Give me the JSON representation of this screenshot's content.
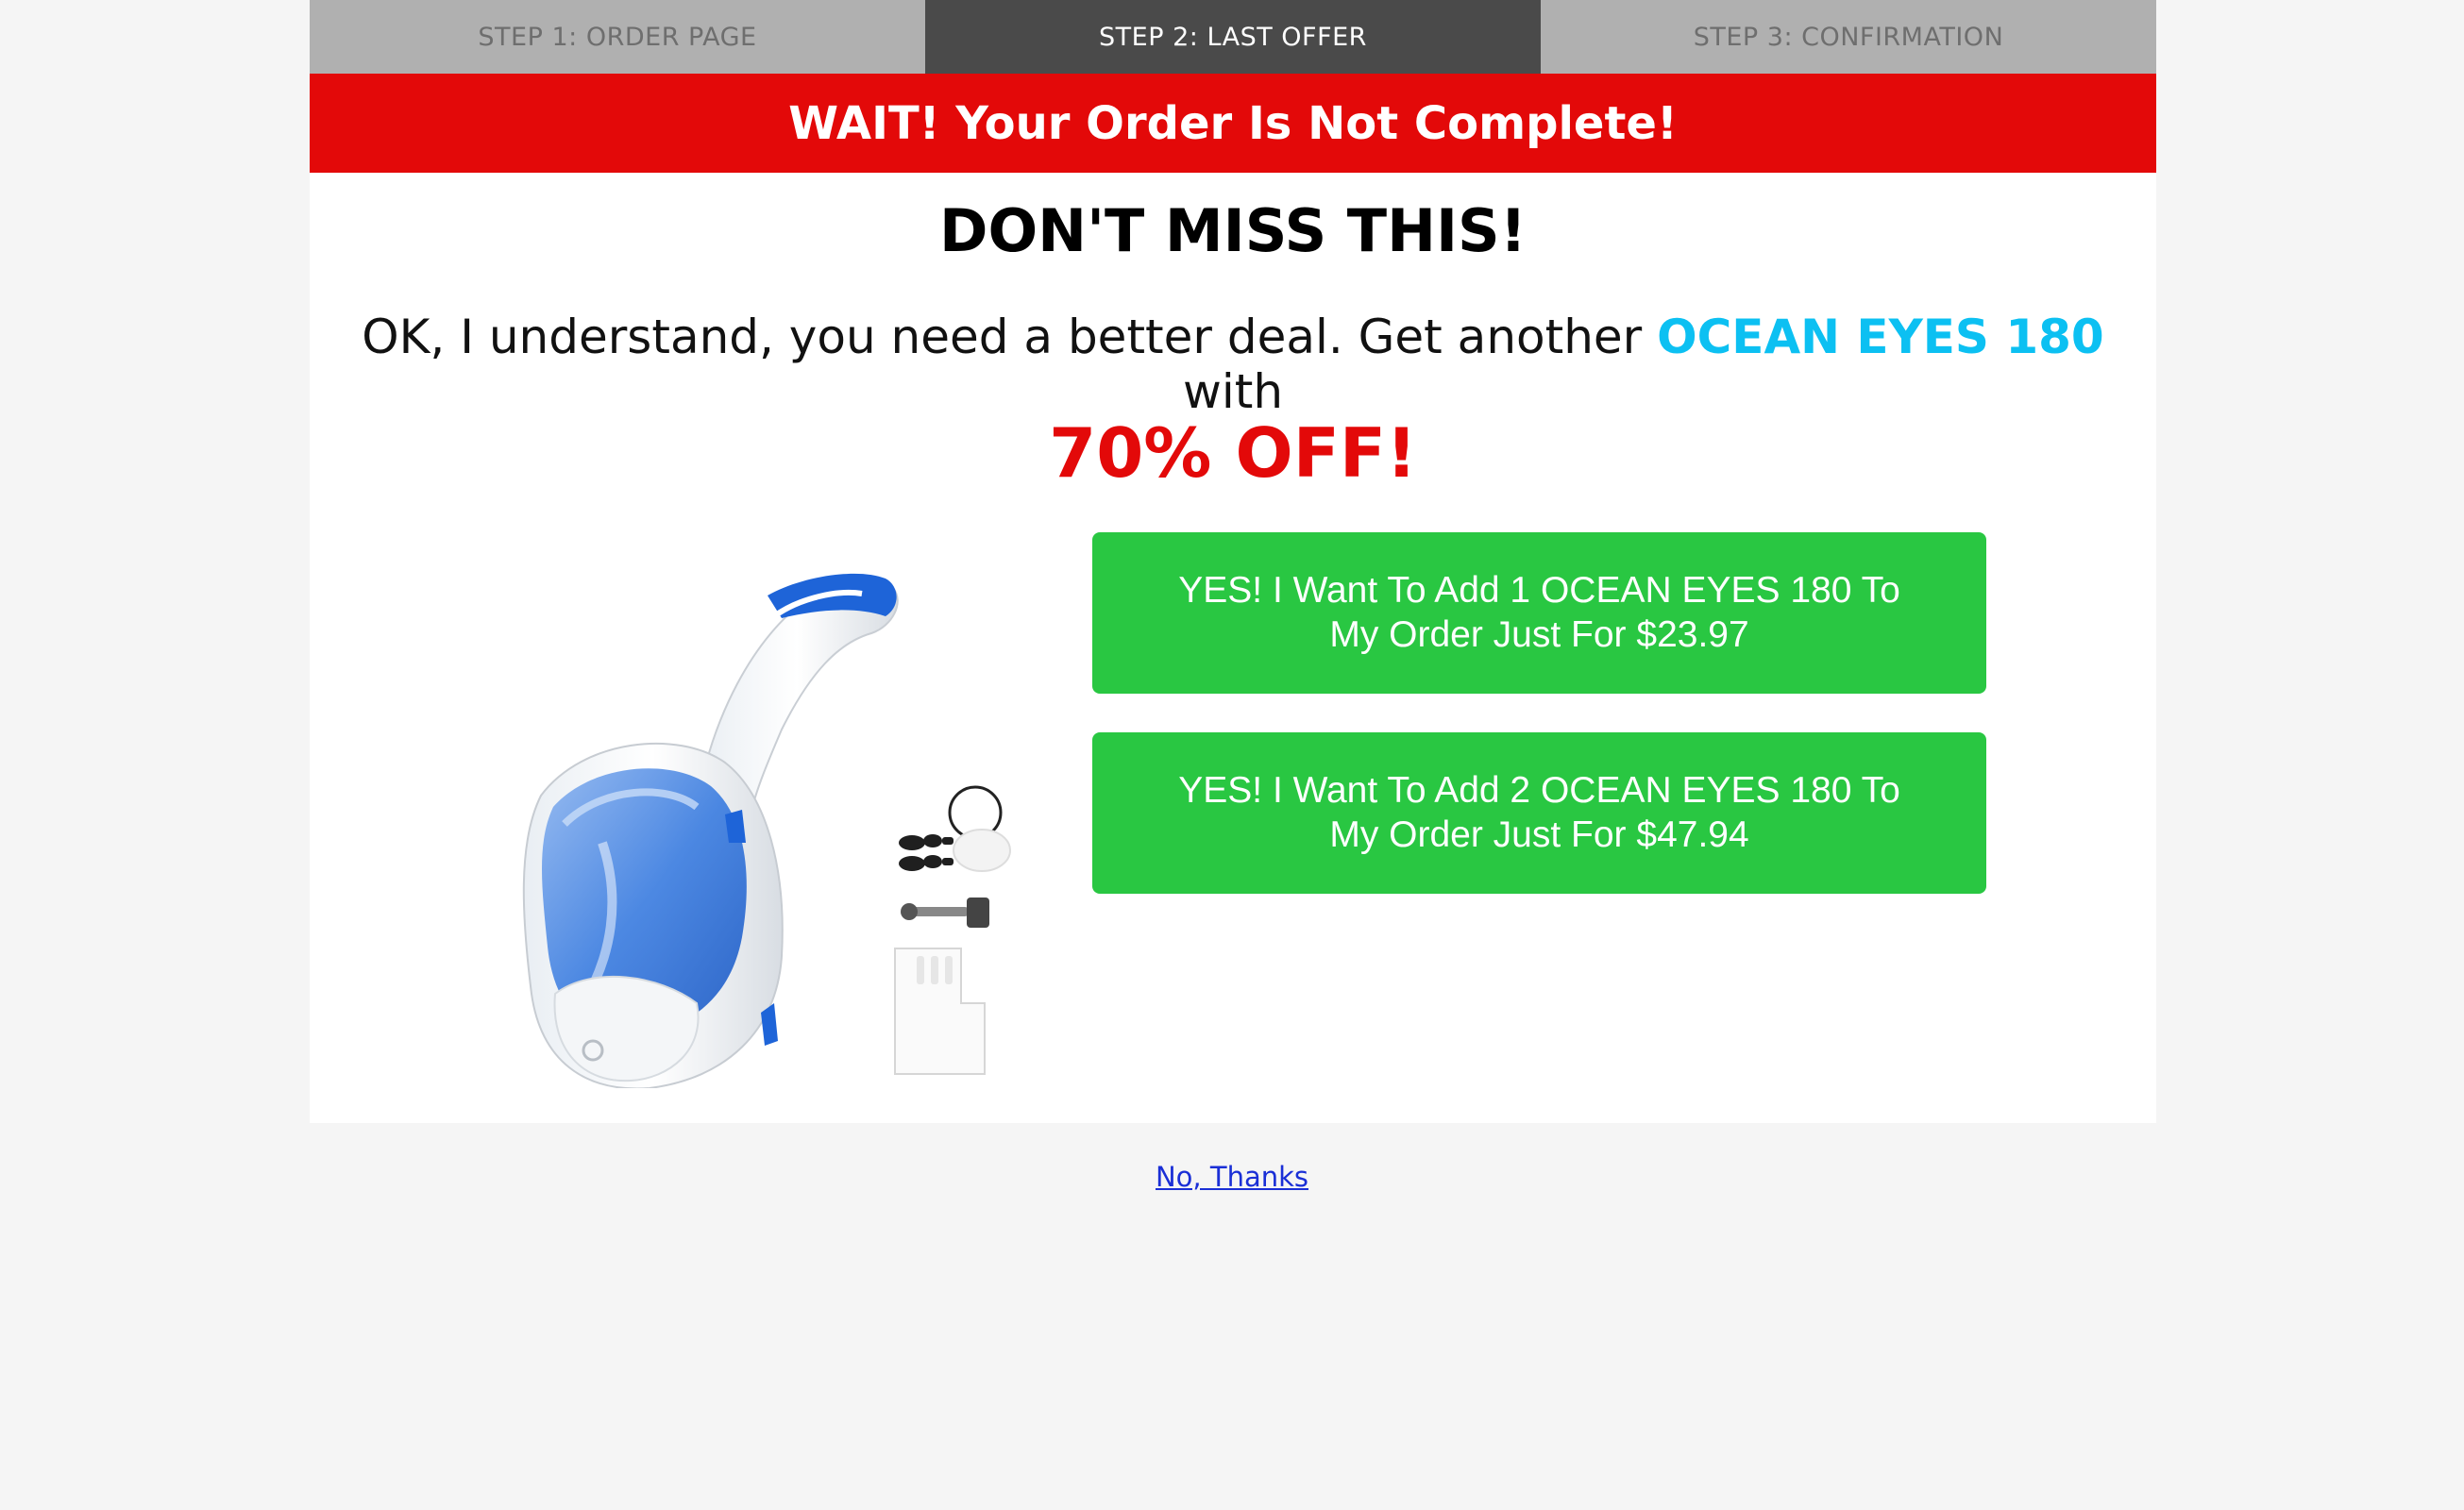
{
  "steps": [
    {
      "label": "STEP 1: ORDER PAGE",
      "active": false
    },
    {
      "label": "STEP 2: LAST OFFER",
      "active": true
    },
    {
      "label": "STEP 3: CONFIRMATION",
      "active": false
    }
  ],
  "banner": {
    "text": "WAIT! Your Order Is Not Complete!"
  },
  "headline": "DON'T MISS THIS!",
  "subline": {
    "prefix": "OK, I understand, you need a better deal. Get another ",
    "product": "OCEAN EYES 180",
    "suffix": " with"
  },
  "discount": "70% OFF!",
  "offers": [
    {
      "label": "YES! I Want To Add 1 OCEAN EYES 180 To My Order Just For $23.97"
    },
    {
      "label": "YES! I Want To Add 2 OCEAN EYES 180 To My Order Just For $47.94"
    }
  ],
  "decline": {
    "label": "No, Thanks"
  },
  "colors": {
    "banner": "#e30909",
    "cta": "#29c742",
    "product_name": "#0cc0f2",
    "step_active": "#4a4a4a",
    "step_inactive": "#b0b0b0"
  }
}
